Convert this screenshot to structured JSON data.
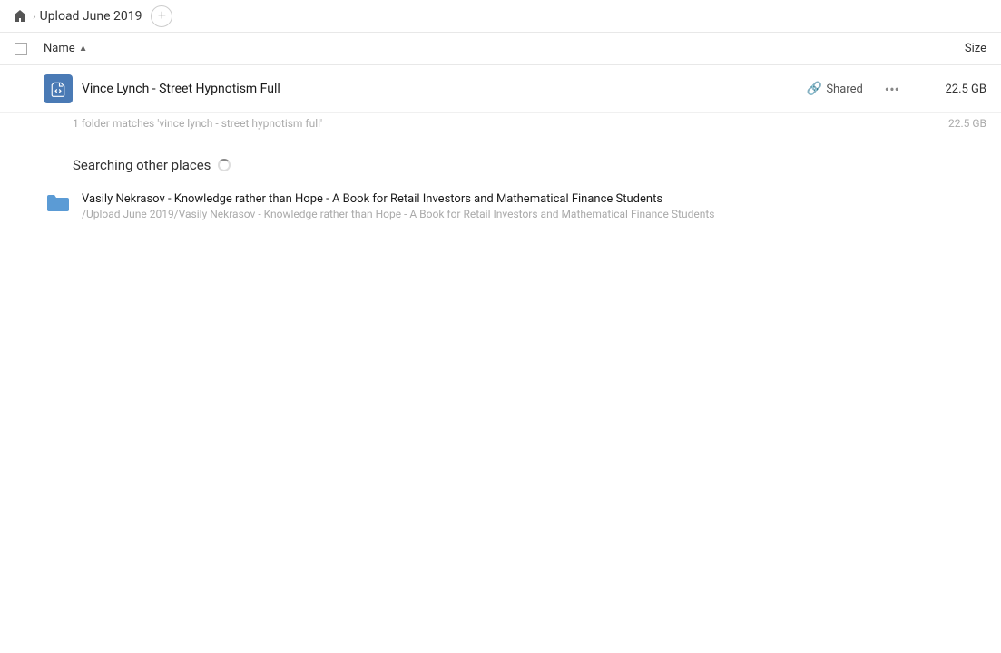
{
  "topbar": {
    "home_icon": "🏠",
    "breadcrumb_arrow": "›",
    "title": "Upload June 2019",
    "add_button": "+"
  },
  "columns": {
    "checkbox_label": "",
    "name_label": "Name",
    "sort_indicator": "▲",
    "size_label": "Size"
  },
  "main_result": {
    "name": "Vince Lynch - Street Hypnotism Full",
    "shared_label": "Shared",
    "size": "22.5 GB",
    "match_hint": "1 folder matches 'vince lynch - street hypnotism full'",
    "match_size": "22.5 GB"
  },
  "other_places": {
    "section_title": "Searching other places",
    "result": {
      "name": "Vasily Nekrasov - Knowledge rather than Hope - A Book for Retail Investors and Mathematical Finance Students",
      "path": "/Upload June 2019/Vasily Nekrasov - Knowledge rather than Hope - A Book for Retail Investors and Mathematical Finance Students"
    }
  }
}
